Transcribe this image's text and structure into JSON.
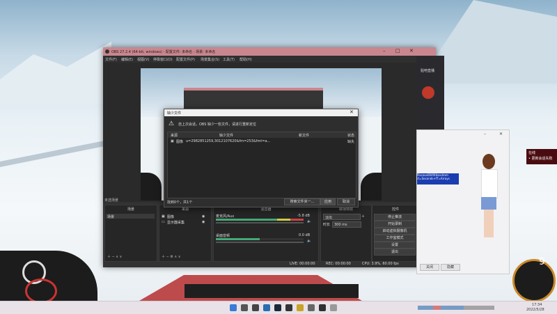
{
  "obs": {
    "title": "OBS 27.2.4 (64-bit, windows) - 配置文件: 未命名 - 场景: 未命名",
    "menu": [
      "文件(F)",
      "编辑(E)",
      "视图(V)",
      "停靠窗口(D)",
      "配置文件(P)",
      "场景集合(S)",
      "工具(T)",
      "帮助(H)"
    ],
    "dock_titles": {
      "scenes": "场景",
      "sources": "来源",
      "mixer": "混音器",
      "transitions": "转场特效",
      "controls": "控件"
    },
    "scene_item": "场景",
    "sources": [
      "图像",
      "显示器采集"
    ],
    "mixer": [
      {
        "name": "麦克风/Aux",
        "db": "-5.8 dB"
      },
      {
        "name": "桌面音频",
        "db": "0.0 dB"
      }
    ],
    "transition": {
      "value": "淡出",
      "duration_label": "时长",
      "duration_value": "300 ms"
    },
    "controls": [
      "停止推流",
      "开始录制",
      "启动虚拟摄像机",
      "工作室模式",
      "设置",
      "退出"
    ],
    "status": {
      "live": "LIVE: 00:00:00",
      "rec": "REC: 00:00:00",
      "cpu": "CPU: 3.9%, 60.00 fps"
    },
    "scenes_label": "未选场景"
  },
  "dialog": {
    "title": "缺少文件",
    "message": "自上次会话，OBS 缺少一些文件，请进行重新定位",
    "columns": [
      "来源",
      "缺少文件",
      "新文件",
      "状态"
    ],
    "row": {
      "source": "图像",
      "missing": "u=2982851259,3012107620&fm=253&fmt=a...",
      "new": "",
      "state": "缺失"
    },
    "footer": "找到0个，共1个",
    "buttons": {
      "search": "搜索文件夹一...",
      "apply": "应用",
      "cancel": "取消"
    }
  },
  "right": {
    "chat_label": "贴吧直播",
    "notice_line1": "在线",
    "notice_line2": "• 更新会话失败",
    "avatar_buttons": [
      "关闭",
      "隐藏"
    ],
    "code_lines": [
      "Pixcoxx004f40secImm",
      "rt=Seconds+fT=Arrays"
    ]
  },
  "game": {
    "hud_level": "9"
  },
  "taskbar": {
    "time": "17:34",
    "date": "2022/5/28"
  },
  "colors": {
    "obs_title": "#c9868e",
    "accent": "#4a90d9",
    "live_red": "#c0392b"
  }
}
